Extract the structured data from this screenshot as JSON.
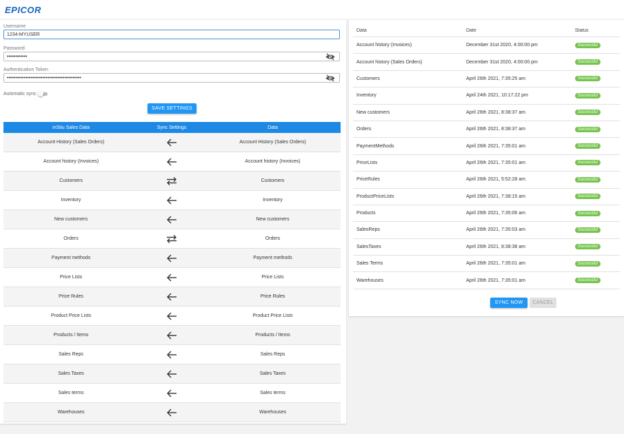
{
  "header": {
    "logo_text": "EPICOR",
    "brand_color": "#1565c0"
  },
  "settings": {
    "username_label": "Username",
    "username_value": "1234-MYUSER",
    "password_label": "Password",
    "password_value": "••••••••••••",
    "token_label": "Authentication Token",
    "token_value": "••••••••••••••••••••••••••••••••••••••••••••",
    "auto_sync_label": "Automatic sync",
    "auto_sync_on": false,
    "save_button": "SAVE SETTINGS"
  },
  "mapping": {
    "headers": [
      "inStiu Sales Data",
      "Sync Settings",
      "Data"
    ],
    "rows": [
      {
        "left": "Account History (Sales Orders)",
        "direction": "left",
        "right": "Account History (Sales Orders)"
      },
      {
        "left": "Account history (Invoices)",
        "direction": "left",
        "right": "Account history (Invoices)"
      },
      {
        "left": "Customers",
        "direction": "both",
        "right": "Customers"
      },
      {
        "left": "Inventory",
        "direction": "left",
        "right": "Inventory"
      },
      {
        "left": "New customers",
        "direction": "left",
        "right": "New customers"
      },
      {
        "left": "Orders",
        "direction": "both",
        "right": "Orders"
      },
      {
        "left": "Payment methods",
        "direction": "left",
        "right": "Payment methods"
      },
      {
        "left": "Price Lists",
        "direction": "left",
        "right": "Price Lists"
      },
      {
        "left": "Price Rules",
        "direction": "left",
        "right": "Price Rules"
      },
      {
        "left": "Product Price Lists",
        "direction": "left",
        "right": "Product Price Lists"
      },
      {
        "left": "Products / Items",
        "direction": "left",
        "right": "Products / Items"
      },
      {
        "left": "Sales Reps",
        "direction": "left",
        "right": "Sales Reps"
      },
      {
        "left": "Sales Taxes",
        "direction": "left",
        "right": "Sales Taxes"
      },
      {
        "left": "Sales terms",
        "direction": "left",
        "right": "Sales terms"
      },
      {
        "left": "Warehouses",
        "direction": "left",
        "right": "Warehouses"
      }
    ]
  },
  "status": {
    "headers": [
      "Data",
      "Date",
      "Status"
    ],
    "rows": [
      {
        "data": "Account history (Invoices)",
        "date": "December 31st 2020, 4:00:00 pm",
        "status": "Successful"
      },
      {
        "data": "Account history (Sales Orders)",
        "date": "December 31st 2020, 4:00:00 pm",
        "status": "Successful"
      },
      {
        "data": "Customers",
        "date": "April 26th 2021, 7:35:25 am",
        "status": "Successful"
      },
      {
        "data": "Inventory",
        "date": "April 24th 2021, 10:17:22 pm",
        "status": "Successful"
      },
      {
        "data": "New customers",
        "date": "April 26th 2021, 8:38:37 am",
        "status": "Successful"
      },
      {
        "data": "Orders",
        "date": "April 26th 2021, 8:38:37 am",
        "status": "Successful"
      },
      {
        "data": "PaymentMethods",
        "date": "April 26th 2021, 7:35:01 am",
        "status": "Successful"
      },
      {
        "data": "PriceLists",
        "date": "April 26th 2021, 7:35:01 am",
        "status": "Successful"
      },
      {
        "data": "PriceRules",
        "date": "April 26th 2021, 5:52:28 am",
        "status": "Successful"
      },
      {
        "data": "ProductPriceLists",
        "date": "April 26th 2021, 7:38:15 am",
        "status": "Successful"
      },
      {
        "data": "Products",
        "date": "April 26th 2021, 7:35:06 am",
        "status": "Successful"
      },
      {
        "data": "SalesReps",
        "date": "April 26th 2021, 7:35:03 am",
        "status": "Successful"
      },
      {
        "data": "SalesTaxes",
        "date": "April 26th 2021, 8:38:38 am",
        "status": "Successful"
      },
      {
        "data": "Sales Terms",
        "date": "April 26th 2021, 7:35:01 am",
        "status": "Successful"
      },
      {
        "data": "Warehouses",
        "date": "April 26th 2021, 7:35:01 am",
        "status": "Successful"
      }
    ],
    "sync_button": "SYNC NOW",
    "cancel_button": "CANCEL"
  },
  "colors": {
    "primary": "#2196f3",
    "table_header": "#1e88e5",
    "success": "#76c44f"
  }
}
